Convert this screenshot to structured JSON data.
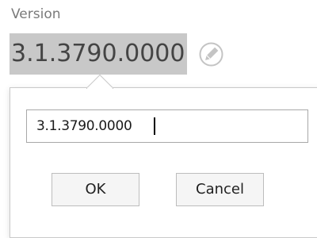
{
  "field": {
    "label": "Version",
    "value": "3.1.3790.0000"
  },
  "edit_icon": "pencil-icon",
  "popup": {
    "input_value": "3.1.3790.0000",
    "ok_label": "OK",
    "cancel_label": "Cancel"
  },
  "colors": {
    "value_highlight": "#c8c8c8",
    "label_text": "#7a7a7a"
  }
}
